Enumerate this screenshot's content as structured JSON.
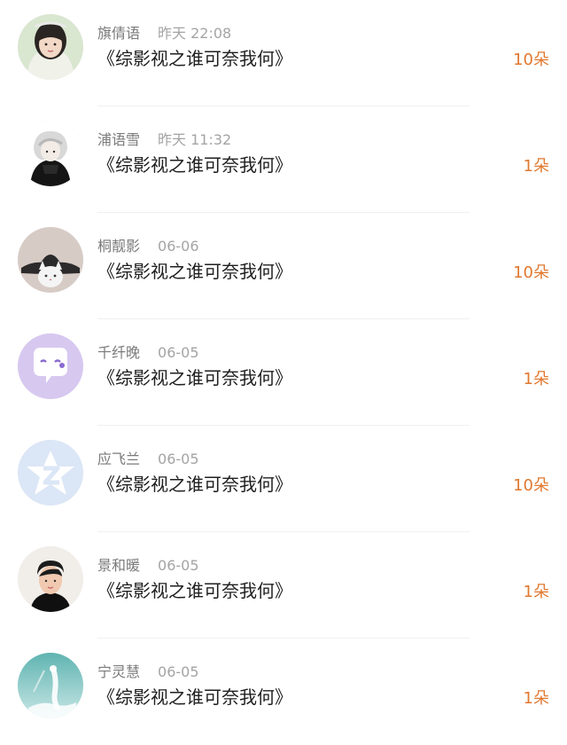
{
  "rows": [
    {
      "name": "旗倩语",
      "time": "昨天 22:08",
      "title": "《综影视之谁可奈我何》",
      "count": "10朵",
      "avatar_icon": "girl-portrait-avatar"
    },
    {
      "name": "浦语雪",
      "time": "昨天 11:32",
      "title": "《综影视之谁可奈我何》",
      "count": "1朵",
      "avatar_icon": "anime-character-avatar"
    },
    {
      "name": "桐靓影",
      "time": "06-06",
      "title": "《综影视之谁可奈我何》",
      "count": "10朵",
      "avatar_icon": "cat-with-hat-avatar"
    },
    {
      "name": "千纤晚",
      "time": "06-05",
      "title": "《综影视之谁可奈我何》",
      "count": "1朵",
      "avatar_icon": "purple-chat-bubble-avatar"
    },
    {
      "name": "应飞兰",
      "time": "06-05",
      "title": "《综影视之谁可奈我何》",
      "count": "10朵",
      "avatar_icon": "blue-star-z-avatar"
    },
    {
      "name": "景和暖",
      "time": "06-05",
      "title": "《综影视之谁可奈我何》",
      "count": "1朵",
      "avatar_icon": "person-photo-avatar"
    },
    {
      "name": "宁灵慧",
      "time": "06-05",
      "title": "《综影视之谁可奈我何》",
      "count": "1朵",
      "avatar_icon": "teal-illustration-avatar"
    }
  ],
  "colors": {
    "count": "#e1782f",
    "name": "#7a7a7a",
    "time": "#a4a4a4",
    "title": "#1f1f1f"
  }
}
